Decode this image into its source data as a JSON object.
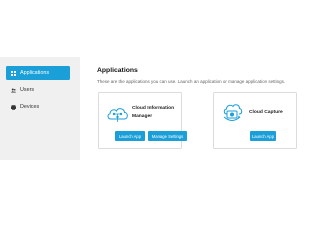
{
  "sidebar": {
    "items": [
      {
        "label": "Applications",
        "icon": "grid-icon",
        "active": true
      },
      {
        "label": "Users",
        "icon": "users-icon",
        "active": false
      },
      {
        "label": "Devices",
        "icon": "devices-icon",
        "active": false
      }
    ]
  },
  "main": {
    "title": "Applications",
    "subtitle": "These are the applications you can use. Launch an application or manage application settings."
  },
  "apps": [
    {
      "name_line1": "Cloud Information",
      "name_line2": "Manager",
      "icon": "cloud-tree-icon",
      "launch_label": "Launch App",
      "manage_label": "Manage Settings"
    },
    {
      "name": "Cloud Capture",
      "icon": "cloud-camera-icon",
      "launch_label": "Launch App"
    }
  ],
  "colors": {
    "accent": "#1a9fd8",
    "sidebar_bg": "#f0f0f0"
  }
}
